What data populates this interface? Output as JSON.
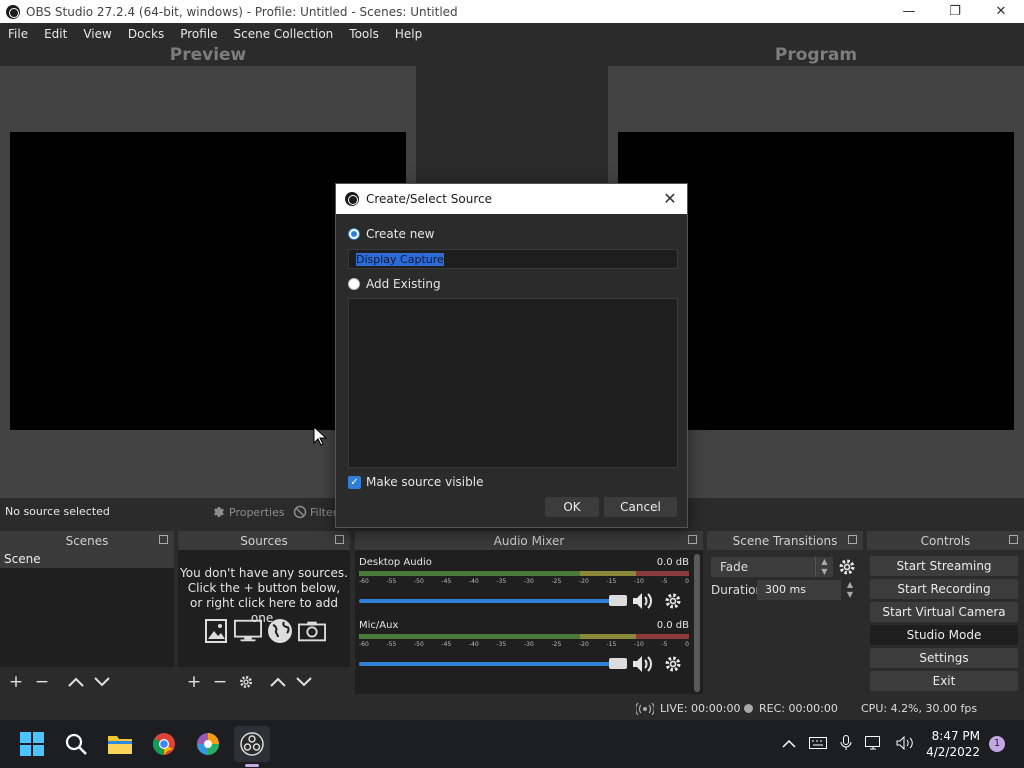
{
  "window": {
    "title": "OBS Studio 27.2.4 (64-bit, windows) - Profile: Untitled - Scenes: Untitled",
    "minimize": "—",
    "maximize": "❐",
    "close": "✕"
  },
  "menu": [
    "File",
    "Edit",
    "View",
    "Docks",
    "Profile",
    "Scene Collection",
    "Tools",
    "Help"
  ],
  "preview": {
    "label": "Preview"
  },
  "program": {
    "label": "Program"
  },
  "source_bar": {
    "status": "No source selected",
    "properties": "Properties",
    "filters": "Filters"
  },
  "scenes": {
    "title": "Scenes",
    "items": [
      "Scene"
    ]
  },
  "sources": {
    "title": "Sources",
    "empty_line1": "You don't have any sources.",
    "empty_line2": "Click the + button below,",
    "empty_line3": "or right click here to add one."
  },
  "mixer": {
    "title": "Audio Mixer",
    "channels": [
      {
        "name": "Desktop Audio",
        "db": "0.0 dB",
        "volume_fraction": 1.0
      },
      {
        "name": "Mic/Aux",
        "db": "0.0 dB",
        "volume_fraction": 1.0
      }
    ],
    "ticks": [
      "-60",
      "-55",
      "-50",
      "-45",
      "-40",
      "-35",
      "-30",
      "-25",
      "-20",
      "-15",
      "-10",
      "-5",
      "0"
    ]
  },
  "transitions": {
    "title": "Scene Transitions",
    "selected": "Fade",
    "duration_label": "Duration",
    "duration_value": "300 ms"
  },
  "controls": {
    "title": "Controls",
    "start_streaming": "Start Streaming",
    "start_recording": "Start Recording",
    "start_virtual_camera": "Start Virtual Camera",
    "studio_mode": "Studio Mode",
    "settings": "Settings",
    "exit": "Exit"
  },
  "status": {
    "live": "LIVE: 00:00:00",
    "rec": "REC: 00:00:00",
    "cpu": "CPU: 4.2%, 30.00 fps"
  },
  "dialog": {
    "title": "Create/Select Source",
    "create_new": "Create new",
    "name_value": "Display Capture",
    "add_existing": "Add Existing",
    "make_visible": "Make source visible",
    "ok": "OK",
    "cancel": "Cancel"
  },
  "taskbar": {
    "time": "8:47 PM",
    "date": "4/2/2022",
    "notifications": "1"
  },
  "colors": {
    "accent": "#2f7fd6",
    "panel": "#2b2b2b",
    "preview_bg": "#434343"
  }
}
